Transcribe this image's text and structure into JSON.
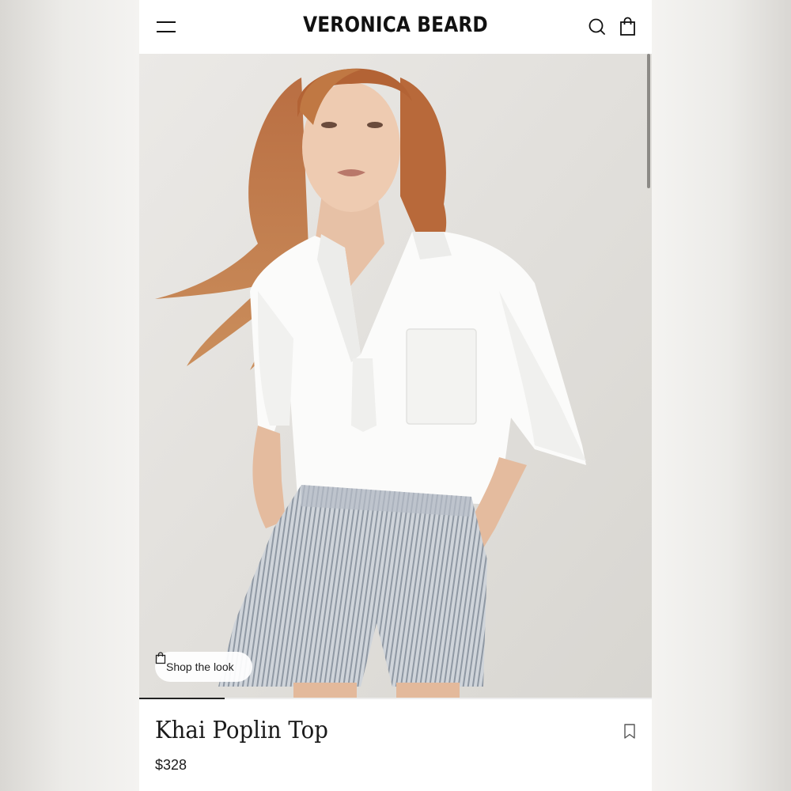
{
  "header": {
    "brand": "VERONICA BEARD",
    "menu_icon": "hamburger-menu-icon",
    "search_icon": "search-icon",
    "cart_icon": "shopping-bag-icon"
  },
  "hero": {
    "image_alt": "Model wearing white poplin top and striped shorts",
    "shop_the_look_label": "Shop the look",
    "shop_the_look_icon": "shopping-bag-icon",
    "gallery_progress": 0.167
  },
  "product": {
    "name": "Khai Poplin Top",
    "price": "$328",
    "bookmark_icon": "bookmark-icon"
  },
  "colors": {
    "text": "#1a1a1a",
    "background": "#ffffff",
    "hero_bg": "#e3e1de"
  }
}
